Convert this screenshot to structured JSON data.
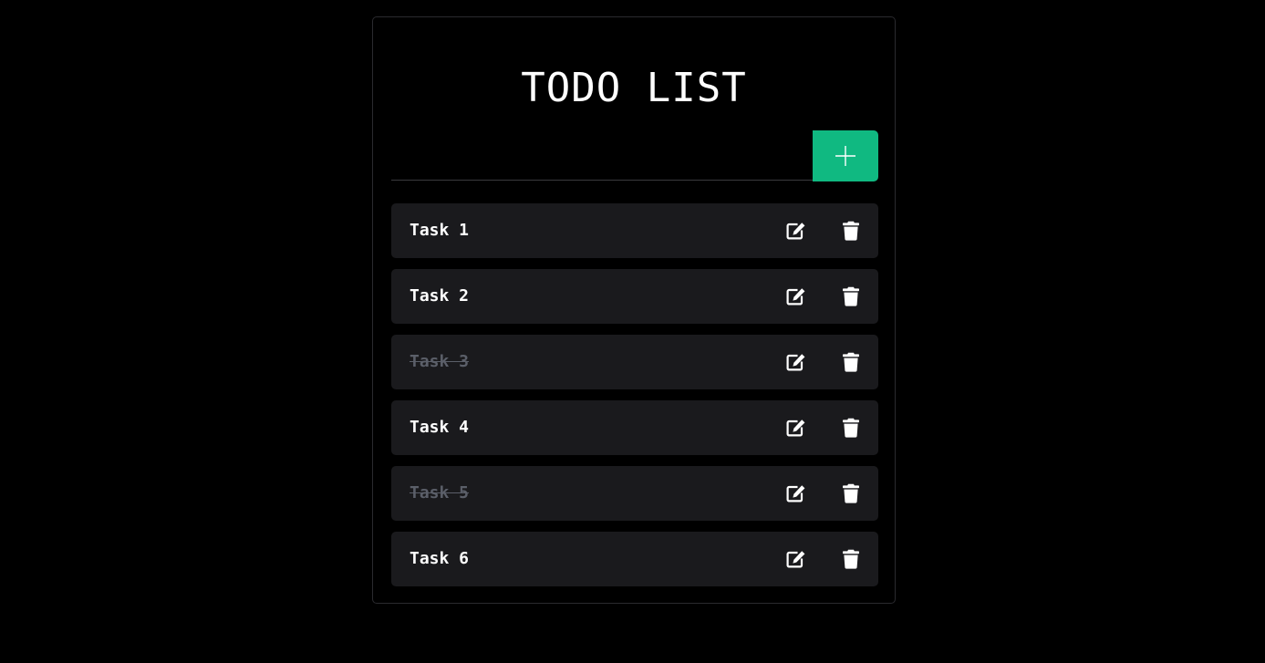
{
  "app": {
    "title": "TODO LIST"
  },
  "input": {
    "value": "",
    "placeholder": ""
  },
  "add_button": {
    "icon": "plus-icon",
    "color": "#10b981"
  },
  "tasks": [
    {
      "label": "Task 1",
      "completed": false
    },
    {
      "label": "Task 2",
      "completed": false
    },
    {
      "label": "Task 3",
      "completed": true
    },
    {
      "label": "Task 4",
      "completed": false
    },
    {
      "label": "Task 5",
      "completed": true
    },
    {
      "label": "Task 6",
      "completed": false
    }
  ],
  "icons": {
    "edit": "edit-icon",
    "delete": "trash-icon"
  },
  "colors": {
    "background": "#000000",
    "row": "#1a1a1d",
    "accent": "#10b981",
    "text": "#ffffff",
    "completed_text": "#5b5f69"
  }
}
